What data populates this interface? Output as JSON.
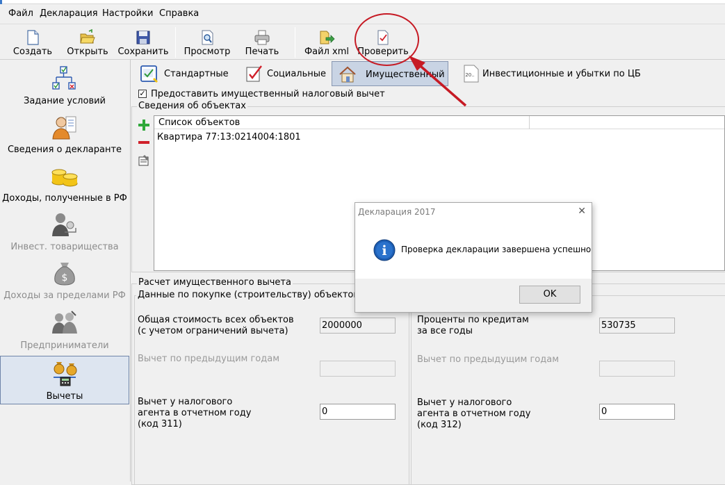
{
  "menu": [
    "Файл",
    "Декларация",
    "Настройки",
    "Справка"
  ],
  "toolbar": {
    "create": "Создать",
    "open": "Открыть",
    "save": "Сохранить",
    "preview": "Просмотр",
    "print": "Печать",
    "xml": "Файл xml",
    "check": "Проверить"
  },
  "nav": [
    {
      "label": "Задание условий",
      "icon": "conditions-icon",
      "enabled": true
    },
    {
      "label": "Сведения о декларанте",
      "icon": "declarant-icon",
      "enabled": true
    },
    {
      "label": "Доходы, полученные в РФ",
      "icon": "coins-icon",
      "enabled": true
    },
    {
      "label": "Инвест. товарищества",
      "icon": "partnership-icon",
      "enabled": false
    },
    {
      "label": "Доходы за пределами РФ",
      "icon": "money-bag-icon",
      "enabled": false
    },
    {
      "label": "Предприниматели",
      "icon": "entrepreneurs-icon",
      "enabled": false
    },
    {
      "label": "Вычеты",
      "icon": "deductions-icon",
      "enabled": true,
      "selected": true
    }
  ],
  "tabs": {
    "standard": "Стандартные",
    "social": "Социальные",
    "property": "Имущественный",
    "investment": "Инвестиционные и убытки по ЦБ",
    "investment_icon_text": "20.."
  },
  "checkbox": {
    "label": "Предоставить имущественный налоговый вычет",
    "checked": true,
    "mark": "✓"
  },
  "objects": {
    "group_title": "Сведения об объектах",
    "column_header": "Список объектов",
    "items": [
      "Квартира 77:13:0214004:1801"
    ]
  },
  "calc": {
    "group_title": "Расчет имущественного вычета",
    "subgroup_title": "Данные по покупке (строительству) объектов",
    "total_cost_label": "Общая стоимость всех объектов (с учетом ограничений вычета)",
    "total_cost_value": "2000000",
    "prev_years_label_left": "Вычет по предыдущим годам",
    "prev_years_value_left": "",
    "agent_label_left": "Вычет у налогового агента в отчетном году (код 311)",
    "agent_value_left": "0",
    "interest_label": "Проценты по кредитам за все годы",
    "interest_value": "530735",
    "prev_years_label_right": "Вычет по предыдущим годам",
    "prev_years_value_right": "",
    "agent_label_right": "Вычет у налогового агента в отчетном году (код 312)",
    "agent_value_right": "0"
  },
  "dialog": {
    "title": "Декларация 2017",
    "close": "✕",
    "icon_glyph": "i",
    "message": "Проверка декларации завершена успешно",
    "ok": "OK"
  },
  "colors": {
    "annotation": "#c61a24",
    "selected_nav": "#dde5f0",
    "active_tab": "#c9d4e4",
    "info_icon": "#1e5fb4"
  }
}
